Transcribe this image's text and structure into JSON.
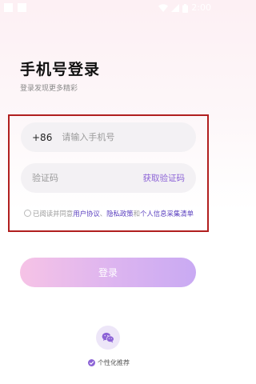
{
  "status_bar": {
    "time": "2:00",
    "icons": [
      "wifi-icon",
      "signal-icon",
      "battery-icon"
    ]
  },
  "header": {
    "title": "手机号登录",
    "subtitle": "登录发现更多精彩"
  },
  "form": {
    "country_code": "+86",
    "phone_placeholder": "请输入手机号",
    "code_placeholder": "验证码",
    "get_code_label": "获取验证码"
  },
  "agreement": {
    "prefix": "已阅读并同意",
    "user_agreement": "用户协议",
    "separator": "、",
    "privacy_policy": "隐私政策",
    "conjunction": "和",
    "personal_info_list": "个人信息采集清单"
  },
  "login": {
    "label": "登录"
  },
  "third_party": {
    "icon": "wechat-icon"
  },
  "personalized": {
    "label": "个性化推荐",
    "checked": true
  },
  "colors": {
    "accent": "#8c63d6",
    "link": "#5a3fbf",
    "highlight_frame": "#b11f1f",
    "login_gradient_start": "#f6c3e6",
    "login_gradient_end": "#c9aaf3"
  }
}
